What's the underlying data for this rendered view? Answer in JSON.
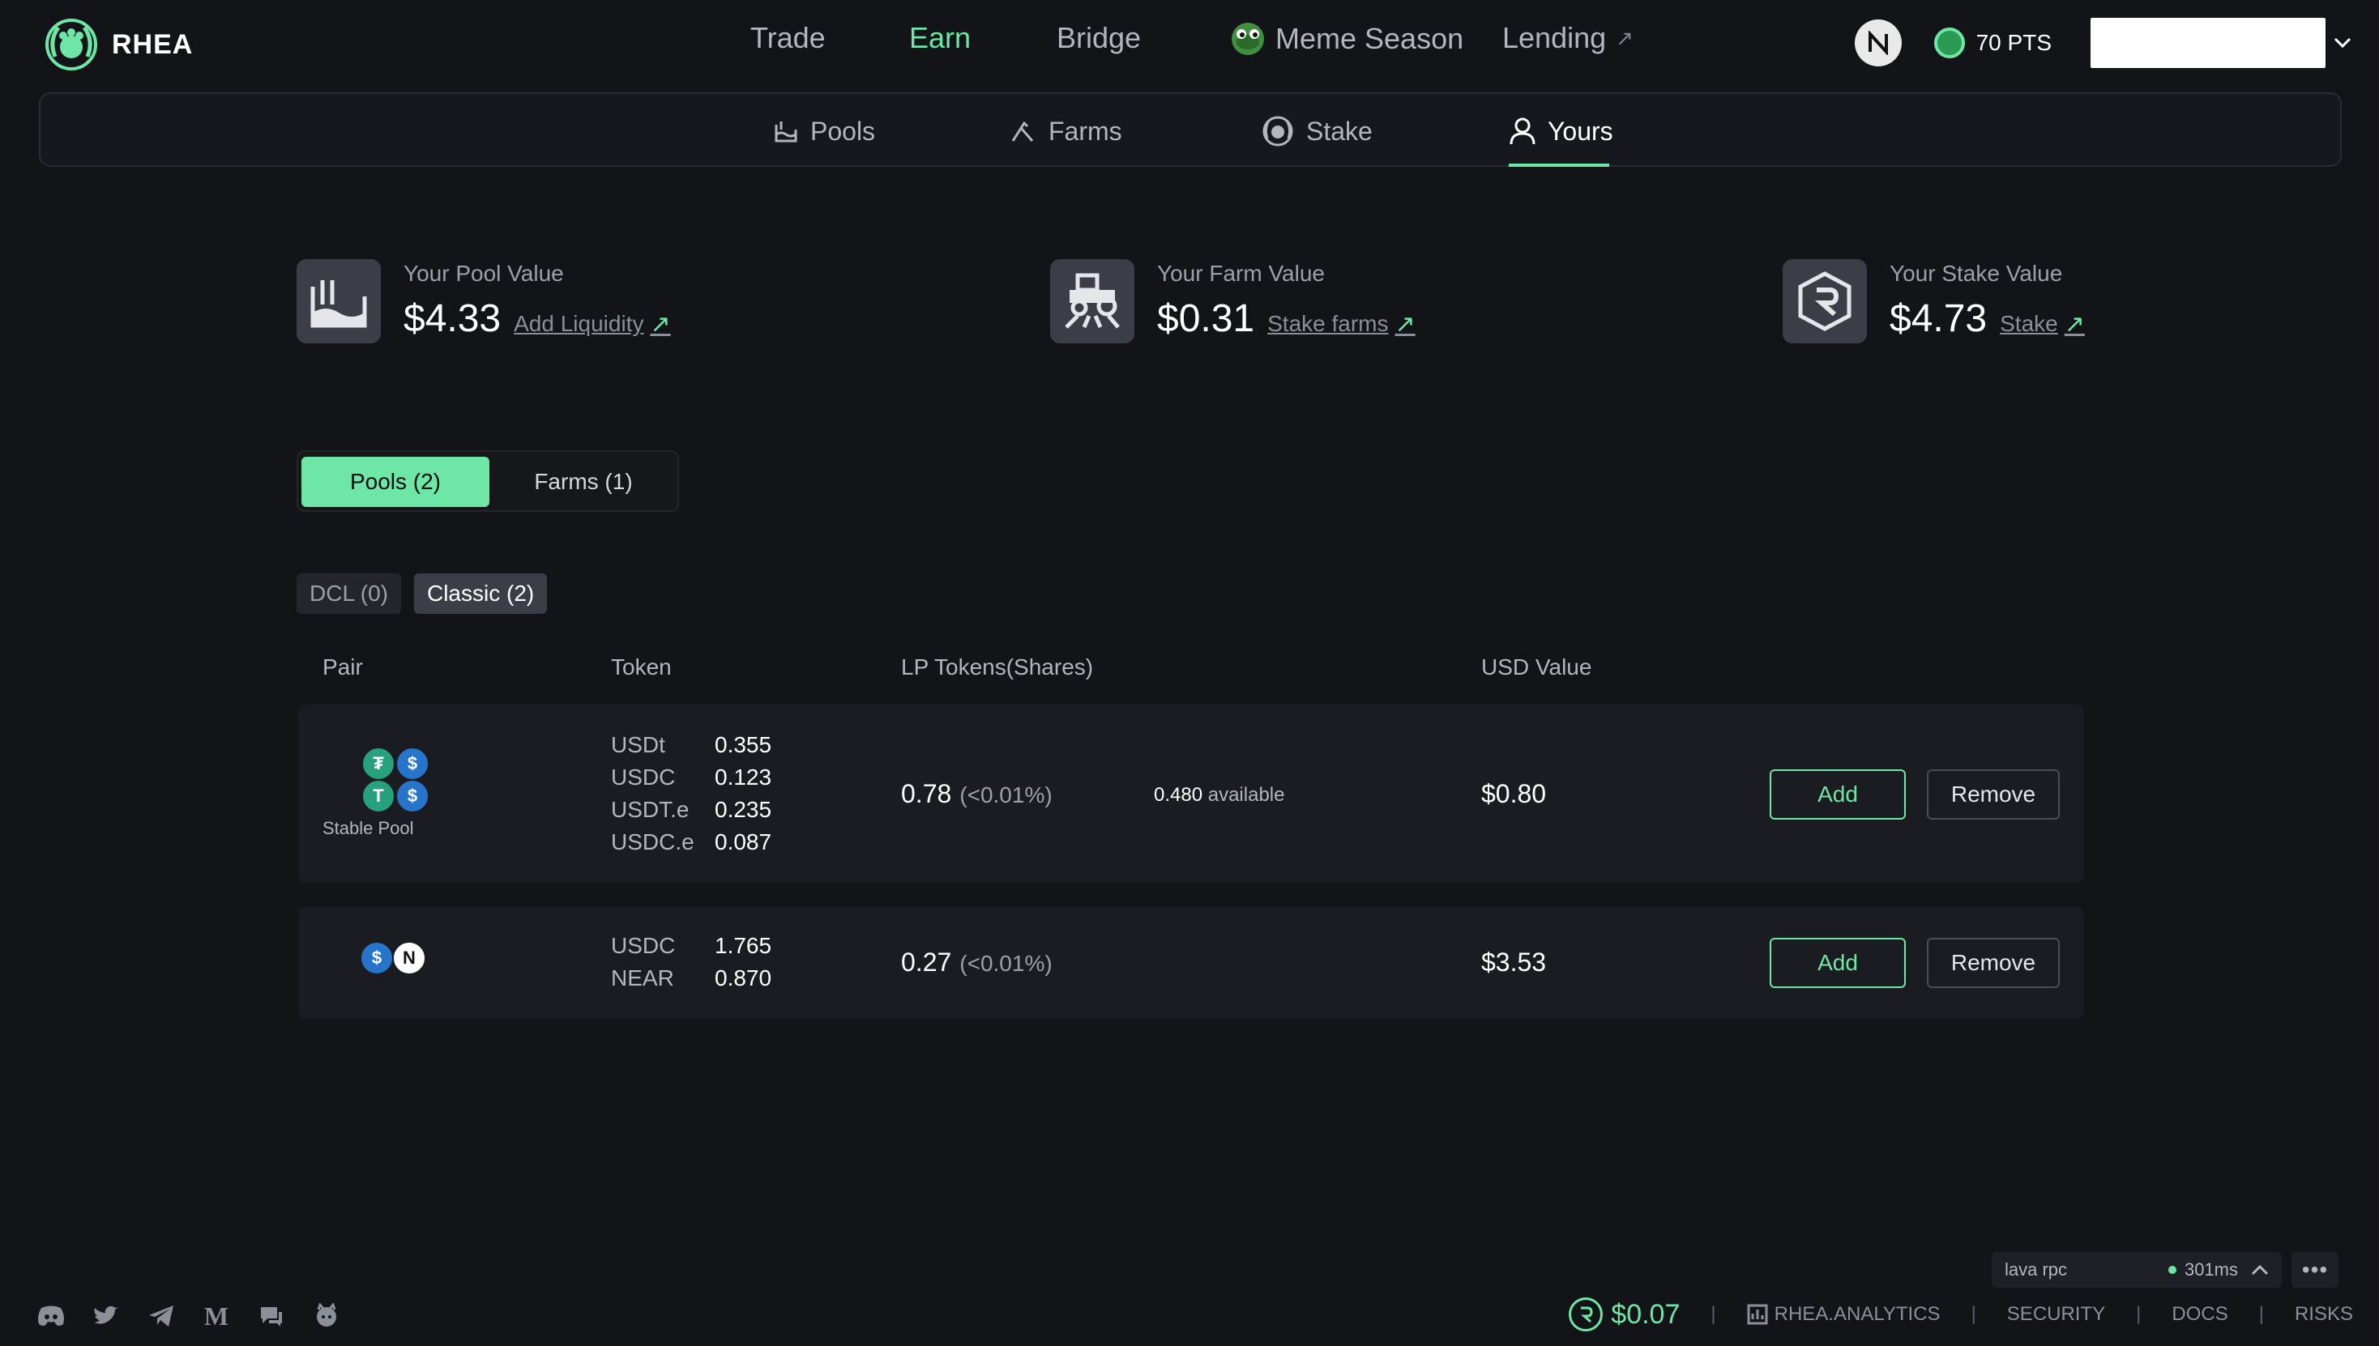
{
  "brand": {
    "name": "RHEA",
    "accent": "#6ee7a6",
    "background": "#131418"
  },
  "nav": {
    "trade": "Trade",
    "earn": "Earn",
    "bridge": "Bridge",
    "meme": "Meme Season",
    "lending": "Lending",
    "lending_ext": "↗"
  },
  "account": {
    "points": "70 PTS"
  },
  "subnav": {
    "pools": "Pools",
    "farms": "Farms",
    "stake": "Stake",
    "yours": "Yours"
  },
  "stats": {
    "pool": {
      "label": "Your Pool Value",
      "value": "$4.33",
      "link": "Add Liquidity"
    },
    "farm": {
      "label": "Your Farm Value",
      "value": "$0.31",
      "link": "Stake farms"
    },
    "stake": {
      "label": "Your Stake Value",
      "value": "$4.73",
      "link": "Stake"
    },
    "arrow": "↗"
  },
  "tabs": {
    "pools": "Pools (2)",
    "farms": "Farms (1)"
  },
  "subtabs": {
    "dcl": "DCL (0)",
    "classic": "Classic (2)"
  },
  "table": {
    "headers": {
      "pair": "Pair",
      "token": "Token",
      "lp": "LP Tokens(Shares)",
      "usd": "USD Value"
    },
    "rows": [
      {
        "pool_label": "Stable Pool",
        "tokens": [
          {
            "symbol": "USDt",
            "amount": "0.355"
          },
          {
            "symbol": "USDC",
            "amount": "0.123"
          },
          {
            "symbol": "USDT.e",
            "amount": "0.235"
          },
          {
            "symbol": "USDC.e",
            "amount": "0.087"
          }
        ],
        "lp": "0.78",
        "lp_pct": "(<0.01%)",
        "available_amount": "0.480",
        "available_label": "available",
        "usd": "$0.80",
        "add": "Add",
        "remove": "Remove"
      },
      {
        "tokens": [
          {
            "symbol": "USDC",
            "amount": "1.765"
          },
          {
            "symbol": "NEAR",
            "amount": "0.870"
          }
        ],
        "lp": "0.27",
        "lp_pct": "(<0.01%)",
        "usd": "$3.53",
        "add": "Add",
        "remove": "Remove"
      }
    ]
  },
  "footer": {
    "rpc_name": "lava rpc",
    "rpc_latency": "301ms",
    "more": "•••",
    "price": "$0.07",
    "analytics": "RHEA.ANALYTICS",
    "security": "SECURITY",
    "docs": "DOCS",
    "risks": "RISKS",
    "separator": "|",
    "socials": [
      "discord-icon",
      "twitter-icon",
      "telegram-icon",
      "medium-icon",
      "forum-icon",
      "github-icon"
    ]
  }
}
